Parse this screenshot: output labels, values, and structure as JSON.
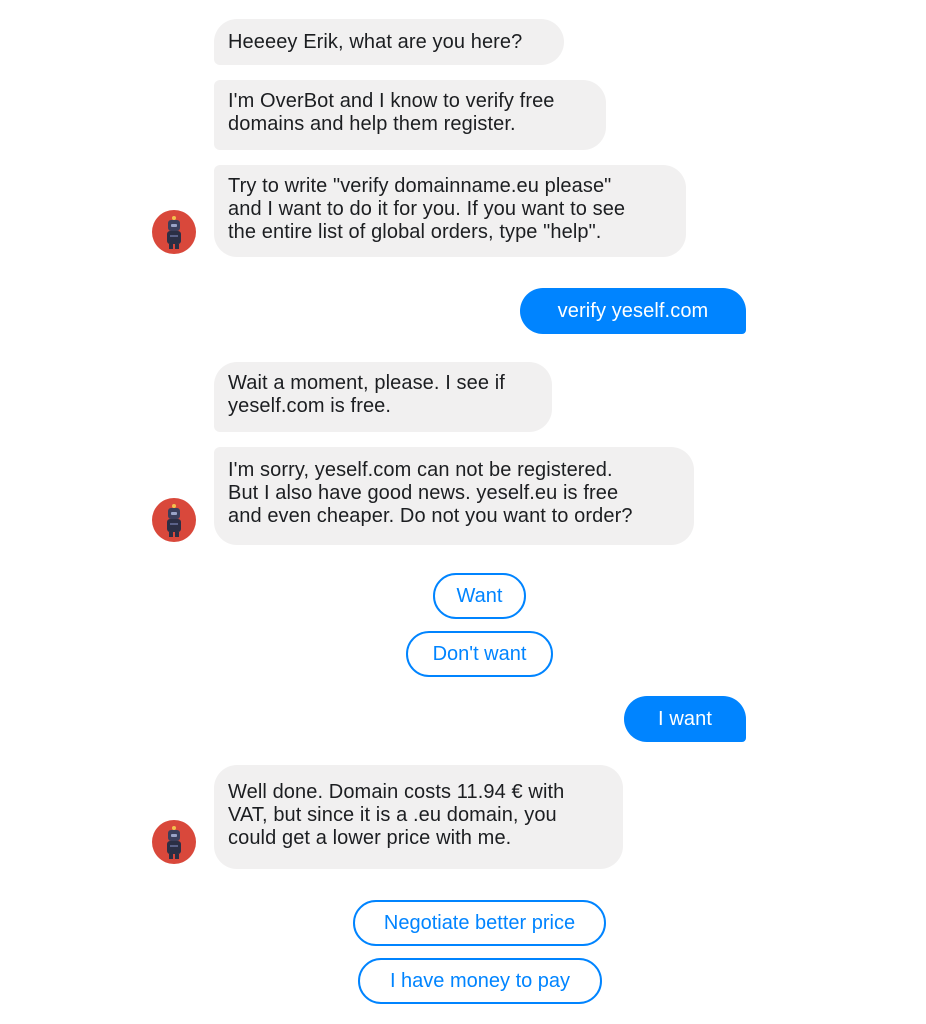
{
  "conversation": {
    "bot_messages": [
      "Heeeey Erik, what are you here?",
      "I'm OverBot and I know to verify free\ndomains and help them register.",
      "Try to write \"verify domainname.eu please\"\nand I want to do it for you. If you want to see\nthe entire list of global orders, type \"help\".",
      "Wait a moment, please. I see if\nyeself.com is free.",
      "I'm sorry, yeself.com can not be registered.\nBut I also have good news. yeself.eu is free\nand even cheaper. Do not you want to order?",
      "Well done. Domain costs 11.94 € with\nVAT, but since it is a .eu domain, you\ncould get a lower price with me."
    ],
    "user_messages": [
      "verify yeself.com",
      "I want"
    ],
    "quick_replies_1": [
      "Want",
      "Don't want"
    ],
    "quick_replies_2": [
      "Negotiate better price",
      "I have money to pay"
    ]
  },
  "colors": {
    "user_bubble": "#0084ff",
    "bot_bubble": "#f1f0f0",
    "quick_reply_border": "#0084ff",
    "avatar_bg": "#d9483b"
  },
  "avatar_icon": "robot-icon"
}
